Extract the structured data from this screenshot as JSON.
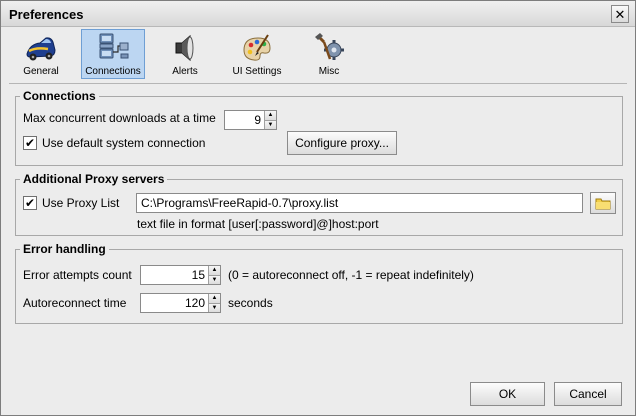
{
  "window": {
    "title": "Preferences",
    "close_glyph": "✕"
  },
  "toolbar": {
    "tabs": [
      {
        "label": "General",
        "icon": "car-icon"
      },
      {
        "label": "Connections",
        "icon": "network-computer-icon",
        "active": true
      },
      {
        "label": "Alerts",
        "icon": "speaker-icon"
      },
      {
        "label": "UI Settings",
        "icon": "palette-icon"
      },
      {
        "label": "Misc",
        "icon": "gears-tools-icon"
      }
    ]
  },
  "connections": {
    "legend": "Connections",
    "max_downloads_label": "Max concurrent downloads at a time",
    "max_downloads_value": "9",
    "default_connection_label": "Use default system connection",
    "default_connection_checked": true,
    "configure_proxy_label": "Configure proxy..."
  },
  "proxy": {
    "legend": "Additional Proxy servers",
    "use_list_label": "Use Proxy List",
    "use_list_checked": true,
    "path_value": "C:\\Programs\\FreeRapid-0.7\\proxy.list",
    "format_hint": "text file in format [user[:password]@]host:port"
  },
  "errors": {
    "legend": "Error handling",
    "attempts_label": "Error attempts count",
    "attempts_value": "15",
    "attempts_hint": "(0 = autoreconnect off, -1 = repeat indefinitely)",
    "reconnect_label": "Autoreconnect time",
    "reconnect_value": "120",
    "reconnect_unit": "seconds"
  },
  "footer": {
    "ok_label": "OK",
    "cancel_label": "Cancel"
  },
  "colors": {
    "active_tab": "#bcd6f2",
    "background": "#ececec"
  }
}
